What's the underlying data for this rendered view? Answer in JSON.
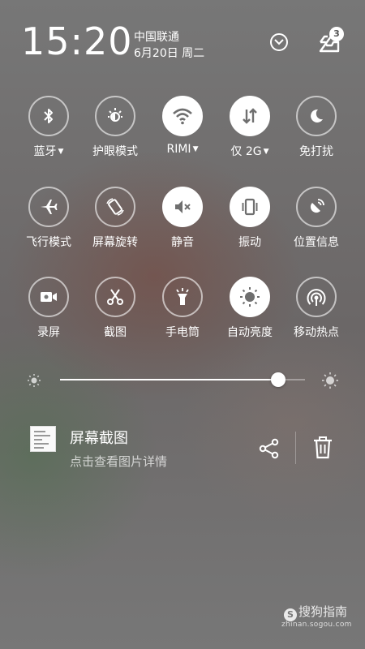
{
  "header": {
    "time": "15:20",
    "carrier": "中国联通",
    "date": "6月20日 周二",
    "notification_count": "3"
  },
  "toggles": [
    {
      "label": "蓝牙",
      "icon": "bluetooth-icon",
      "on": false,
      "dropdown": true
    },
    {
      "label": "护眼模式",
      "icon": "eye-care-icon",
      "on": false,
      "dropdown": false
    },
    {
      "label": "RIMI",
      "icon": "wifi-icon",
      "on": true,
      "dropdown": true
    },
    {
      "label": "仅 2G",
      "icon": "mobile-data-icon",
      "on": true,
      "dropdown": true
    },
    {
      "label": "免打扰",
      "icon": "moon-icon",
      "on": false,
      "dropdown": false
    },
    {
      "label": "飞行模式",
      "icon": "airplane-icon",
      "on": false,
      "dropdown": false
    },
    {
      "label": "屏幕旋转",
      "icon": "rotate-icon",
      "on": false,
      "dropdown": false
    },
    {
      "label": "静音",
      "icon": "mute-icon",
      "on": true,
      "dropdown": false
    },
    {
      "label": "振动",
      "icon": "vibrate-icon",
      "on": true,
      "dropdown": false
    },
    {
      "label": "位置信息",
      "icon": "location-icon",
      "on": false,
      "dropdown": false
    },
    {
      "label": "录屏",
      "icon": "screen-record-icon",
      "on": false,
      "dropdown": false
    },
    {
      "label": "截图",
      "icon": "scissors-icon",
      "on": false,
      "dropdown": false
    },
    {
      "label": "手电筒",
      "icon": "flashlight-icon",
      "on": false,
      "dropdown": false
    },
    {
      "label": "自动亮度",
      "icon": "auto-brightness-icon",
      "on": true,
      "dropdown": false
    },
    {
      "label": "移动热点",
      "icon": "hotspot-icon",
      "on": false,
      "dropdown": false
    }
  ],
  "brightness": {
    "level": 0.89
  },
  "notification": {
    "title": "屏幕截图",
    "subtitle": "点击查看图片详情"
  },
  "watermark": {
    "logo": "S",
    "name": "搜狗指南",
    "url": "zhinan.sogou.com"
  }
}
